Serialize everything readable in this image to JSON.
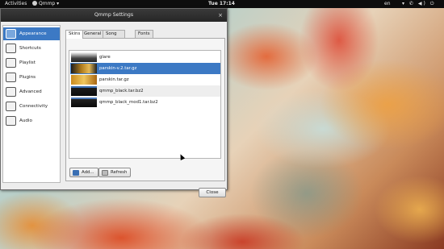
{
  "topbar": {
    "activities": "Activities",
    "app_name": "Qmmp",
    "clock": "Tue 17:14",
    "language": "en",
    "status_icons": "▾ ✆ ◀) ⏻"
  },
  "window": {
    "title": "Qmmp Settings",
    "close_symbol": "×",
    "close_button": "Close"
  },
  "sidebar": {
    "items": [
      {
        "label": "Appearance",
        "icon": "appearance-icon"
      },
      {
        "label": "Shortcuts",
        "icon": "shortcuts-icon"
      },
      {
        "label": "Playlist",
        "icon": "playlist-icon"
      },
      {
        "label": "Plugins",
        "icon": "plugins-icon"
      },
      {
        "label": "Advanced",
        "icon": "advanced-icon"
      },
      {
        "label": "Connectivity",
        "icon": "connectivity-icon"
      },
      {
        "label": "Audio",
        "icon": "audio-icon"
      }
    ]
  },
  "tabs": [
    "Skins",
    "General",
    "Song Display",
    "Fonts"
  ],
  "skins": [
    {
      "name": "glare"
    },
    {
      "name": "parskin-v.2.tar.gz"
    },
    {
      "name": "parskin.tar.gz"
    },
    {
      "name": "qmmp_black.tar.bz2"
    },
    {
      "name": "qmmp_black_mod1.tar.bz2"
    }
  ],
  "buttons": {
    "add": "Add...",
    "refresh": "Refresh"
  },
  "colors": {
    "selection": "#3c79c4",
    "topbar": "#0d0d0d"
  }
}
